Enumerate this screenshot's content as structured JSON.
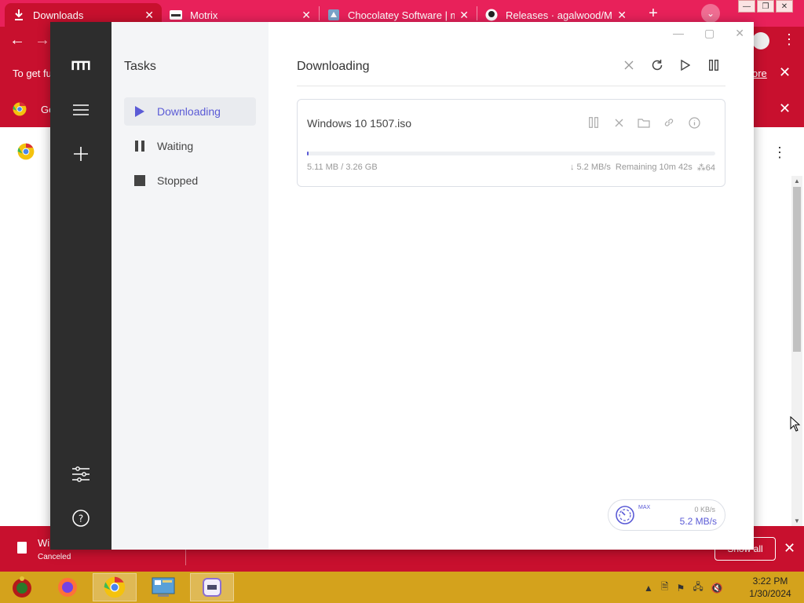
{
  "browser": {
    "tabs": [
      {
        "title": "Downloads",
        "icon": "download-icon",
        "active": true
      },
      {
        "title": "Motrix",
        "icon": "motrix-favicon",
        "active": false
      },
      {
        "title": "Chocolatey Software | mo",
        "icon": "chocolatey-favicon",
        "active": false
      },
      {
        "title": "Releases · agalwood/Mot",
        "icon": "github-icon",
        "active": false
      }
    ],
    "infobar_text": "To get fu",
    "infobar_link": "ore",
    "default_bar_text": "Go",
    "colors": {
      "accent": "#c8102e",
      "tabbar": "#e8215a"
    }
  },
  "download_shelf": {
    "file_name": "Wi",
    "status": "Canceled",
    "show_all": "Show all"
  },
  "taskbar": {
    "time": "3:22 PM",
    "date": "1/30/2024"
  },
  "motrix": {
    "sidebar_title": "Tasks",
    "nav": [
      {
        "label": "Downloading",
        "icon": "play-icon",
        "active": true
      },
      {
        "label": "Waiting",
        "icon": "pause-icon",
        "active": false
      },
      {
        "label": "Stopped",
        "icon": "stop-icon",
        "active": false
      }
    ],
    "header_title": "Downloading",
    "task": {
      "name": "Windows 10 1507.iso",
      "size": "5.11 MB / 3.26 GB",
      "speed": "↓ 5.2 MB/s",
      "remaining": "Remaining 10m 42s",
      "connections": "⁂64",
      "progress": 0.002
    },
    "speedometer": {
      "max_label": "MAX",
      "upload": "0 KB/s",
      "download": "5.2 MB/s"
    },
    "accent": "#5b5bd6"
  }
}
